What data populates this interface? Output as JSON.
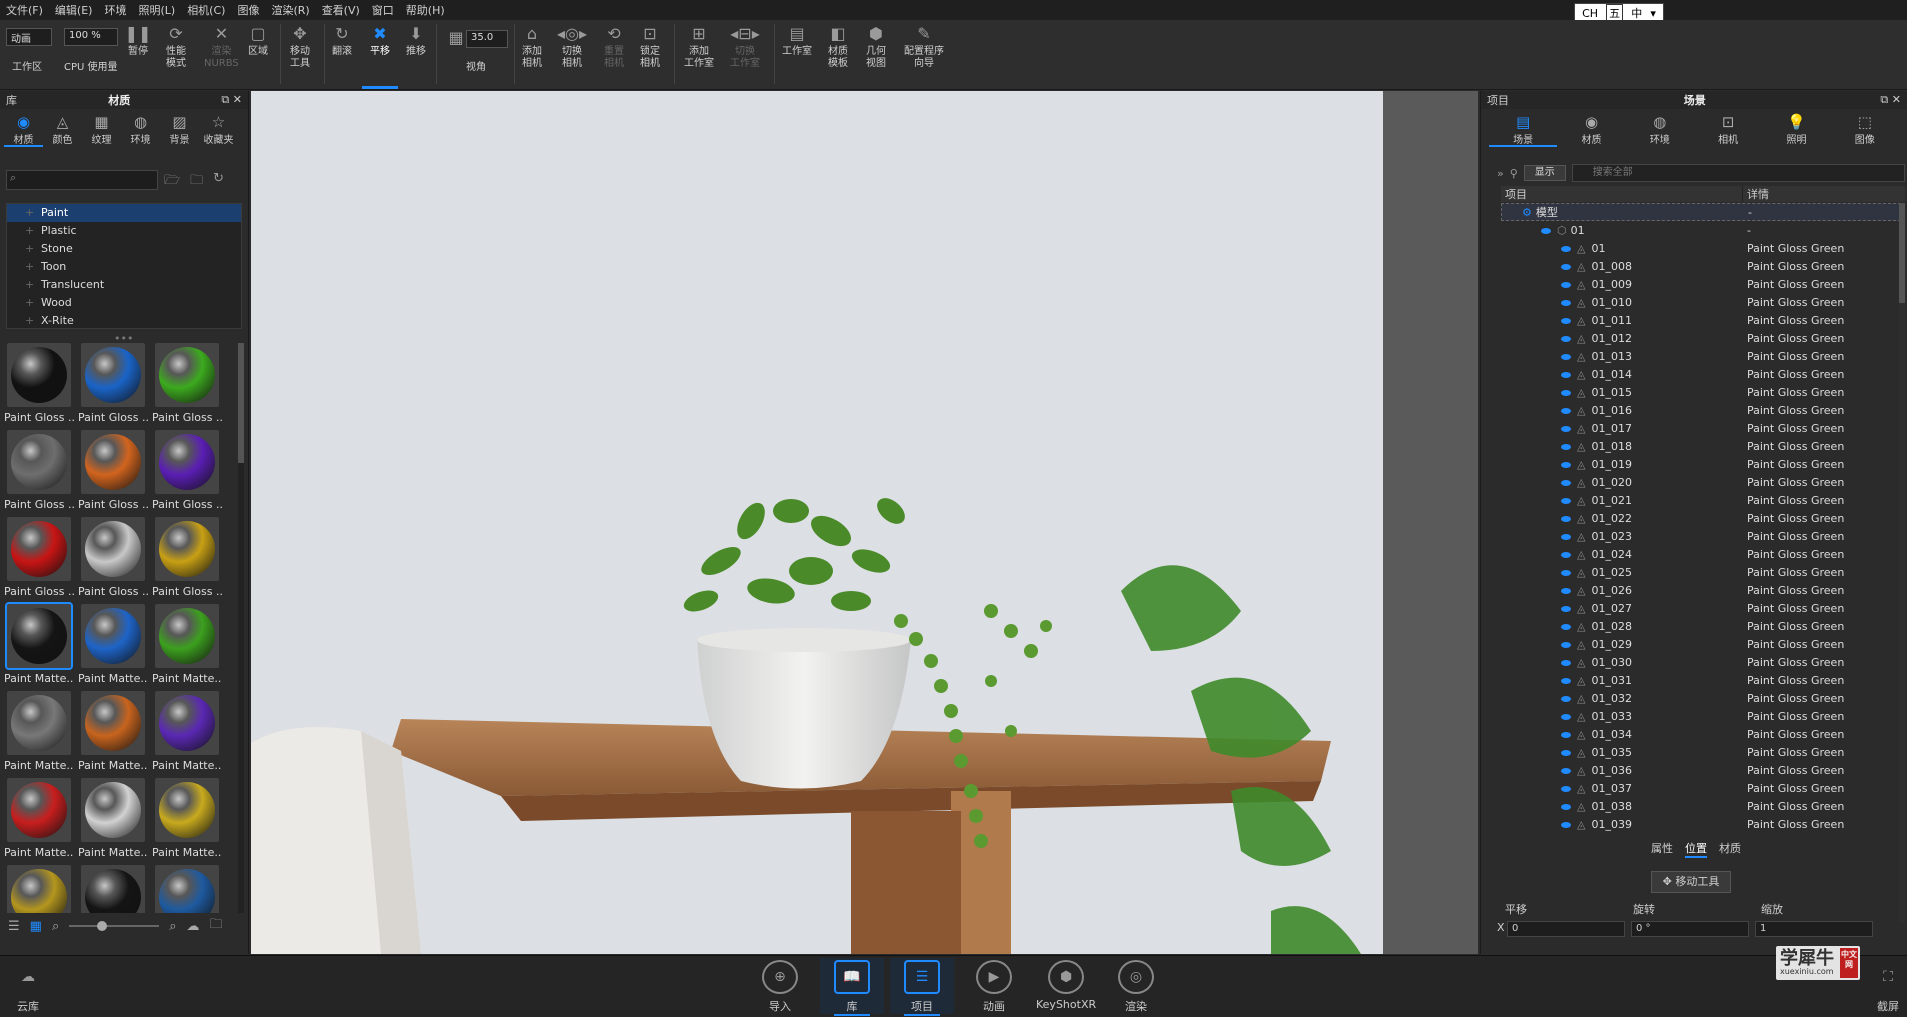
{
  "menu": [
    "文件(F)",
    "编辑(E)",
    "环境",
    "照明(L)",
    "相机(C)",
    "图像",
    "渲染(R)",
    "查看(V)",
    "窗口",
    "帮助(H)"
  ],
  "ime": {
    "lang": "CH",
    "icon": "五",
    "mode": "中"
  },
  "toolbar": {
    "workspace_value": "动画",
    "workspace_label": "工作区",
    "cpu_value": "100 %",
    "cpu_label": "CPU 使用量",
    "pause": "暂停",
    "perf": "性能\n模式",
    "nurbs": "渲染\nNURBS",
    "region": "区域",
    "move_tool": "移动\n工具",
    "tumble": "翻滚",
    "pan": "平移",
    "dolly": "推移",
    "fov_value": "35.0",
    "fov_label": "视角",
    "add_camera": "添加\n相机",
    "switch_camera": "切换\n相机",
    "reset_camera": "重置\n相机",
    "lock_camera": "锁定\n相机",
    "add_studio": "添加\n工作室",
    "switch_studio": "切换\n工作室",
    "studio": "工作室",
    "material_template": "材质\n模板",
    "geometry_view": "几何\n视图",
    "config_wizard": "配置程序\n向导"
  },
  "library": {
    "header_left": "库",
    "header_title": "材质",
    "tabs": [
      "材质",
      "颜色",
      "纹理",
      "环境",
      "背景",
      "收藏夹"
    ],
    "tab_icons": [
      "material-icon",
      "color-icon",
      "texture-icon",
      "environment-icon",
      "background-icon",
      "favorites-icon"
    ],
    "tree": [
      "Paint",
      "Plastic",
      "Stone",
      "Toon",
      "Translucent",
      "Wood",
      "X-Rite"
    ],
    "materials": [
      {
        "label": "Paint Gloss ...",
        "color": "#111111"
      },
      {
        "label": "Paint Gloss ...",
        "color": "#1a64c8"
      },
      {
        "label": "Paint Gloss ...",
        "color": "#3caa1e"
      },
      {
        "label": "Paint Gloss ...",
        "color": "#6e6e6e"
      },
      {
        "label": "Paint Gloss ...",
        "color": "#d2641e"
      },
      {
        "label": "Paint Gloss ...",
        "color": "#5a1eb4"
      },
      {
        "label": "Paint Gloss ...",
        "color": "#c81414"
      },
      {
        "label": "Paint Gloss ...",
        "color": "#c8c8c8"
      },
      {
        "label": "Paint Gloss ...",
        "color": "#c8a014"
      },
      {
        "label": "Paint Matte...",
        "color": "#141414"
      },
      {
        "label": "Paint Matte...",
        "color": "#1e64c8"
      },
      {
        "label": "Paint Matte...",
        "color": "#3ca01e"
      },
      {
        "label": "Paint Matte...",
        "color": "#787878"
      },
      {
        "label": "Paint Matte...",
        "color": "#c8641e"
      },
      {
        "label": "Paint Matte...",
        "color": "#5a28b4"
      },
      {
        "label": "Paint Matte...",
        "color": "#c81e1e"
      },
      {
        "label": "Paint Matte...",
        "color": "#d2d2d2"
      },
      {
        "label": "Paint Matte...",
        "color": "#c8aa1e"
      },
      {
        "label": "",
        "color": "#b4961e"
      },
      {
        "label": "",
        "color": "#141414"
      },
      {
        "label": "",
        "color": "#1e5aa0"
      }
    ]
  },
  "scene": {
    "header_left": "项目",
    "header_title": "场景",
    "tabs": [
      "场景",
      "材质",
      "环境",
      "相机",
      "照明",
      "图像"
    ],
    "tab_icons": [
      "scene-icon",
      "material-icon",
      "environment-icon",
      "camera-icon",
      "light-icon",
      "image-icon"
    ],
    "show_label": "显示",
    "search_placeholder": "搜索全部",
    "col_item": "项目",
    "col_detail": "详情",
    "root": {
      "name": "模型",
      "detail": "-"
    },
    "group": {
      "name": "01",
      "detail": "-"
    },
    "rows": [
      {
        "name": "01",
        "detail": "Paint Gloss Green"
      },
      {
        "name": "01_008",
        "detail": "Paint Gloss Green"
      },
      {
        "name": "01_009",
        "detail": "Paint Gloss Green"
      },
      {
        "name": "01_010",
        "detail": "Paint Gloss Green"
      },
      {
        "name": "01_011",
        "detail": "Paint Gloss Green"
      },
      {
        "name": "01_012",
        "detail": "Paint Gloss Green"
      },
      {
        "name": "01_013",
        "detail": "Paint Gloss Green"
      },
      {
        "name": "01_014",
        "detail": "Paint Gloss Green"
      },
      {
        "name": "01_015",
        "detail": "Paint Gloss Green"
      },
      {
        "name": "01_016",
        "detail": "Paint Gloss Green"
      },
      {
        "name": "01_017",
        "detail": "Paint Gloss Green"
      },
      {
        "name": "01_018",
        "detail": "Paint Gloss Green"
      },
      {
        "name": "01_019",
        "detail": "Paint Gloss Green"
      },
      {
        "name": "01_020",
        "detail": "Paint Gloss Green"
      },
      {
        "name": "01_021",
        "detail": "Paint Gloss Green"
      },
      {
        "name": "01_022",
        "detail": "Paint Gloss Green"
      },
      {
        "name": "01_023",
        "detail": "Paint Gloss Green"
      },
      {
        "name": "01_024",
        "detail": "Paint Gloss Green"
      },
      {
        "name": "01_025",
        "detail": "Paint Gloss Green"
      },
      {
        "name": "01_026",
        "detail": "Paint Gloss Green"
      },
      {
        "name": "01_027",
        "detail": "Paint Gloss Green"
      },
      {
        "name": "01_028",
        "detail": "Paint Gloss Green"
      },
      {
        "name": "01_029",
        "detail": "Paint Gloss Green"
      },
      {
        "name": "01_030",
        "detail": "Paint Gloss Green"
      },
      {
        "name": "01_031",
        "detail": "Paint Gloss Green"
      },
      {
        "name": "01_032",
        "detail": "Paint Gloss Green"
      },
      {
        "name": "01_033",
        "detail": "Paint Gloss Green"
      },
      {
        "name": "01_034",
        "detail": "Paint Gloss Green"
      },
      {
        "name": "01_035",
        "detail": "Paint Gloss Green"
      },
      {
        "name": "01_036",
        "detail": "Paint Gloss Green"
      },
      {
        "name": "01_037",
        "detail": "Paint Gloss Green"
      },
      {
        "name": "01_038",
        "detail": "Paint Gloss Green"
      },
      {
        "name": "01_039",
        "detail": "Paint Gloss Green"
      }
    ],
    "subtabs": [
      "属性",
      "位置",
      "材质"
    ],
    "move_tool": "移动工具",
    "xform": {
      "translate": "平移",
      "rotate": "旋转",
      "scale": "缩放",
      "axis": "X",
      "t_val": "0",
      "r_val": "0 °",
      "s_val": "1"
    }
  },
  "bottom": {
    "cloud": "云库",
    "import": "导入",
    "library": "库",
    "project": "项目",
    "animation": "动画",
    "keyshotxr": "KeyShotXR",
    "render": "渲染",
    "screenshot": "截屏"
  },
  "watermark": {
    "main": "学犀牛",
    "sub": "xuexiniu.com",
    "badge": "中文网"
  }
}
